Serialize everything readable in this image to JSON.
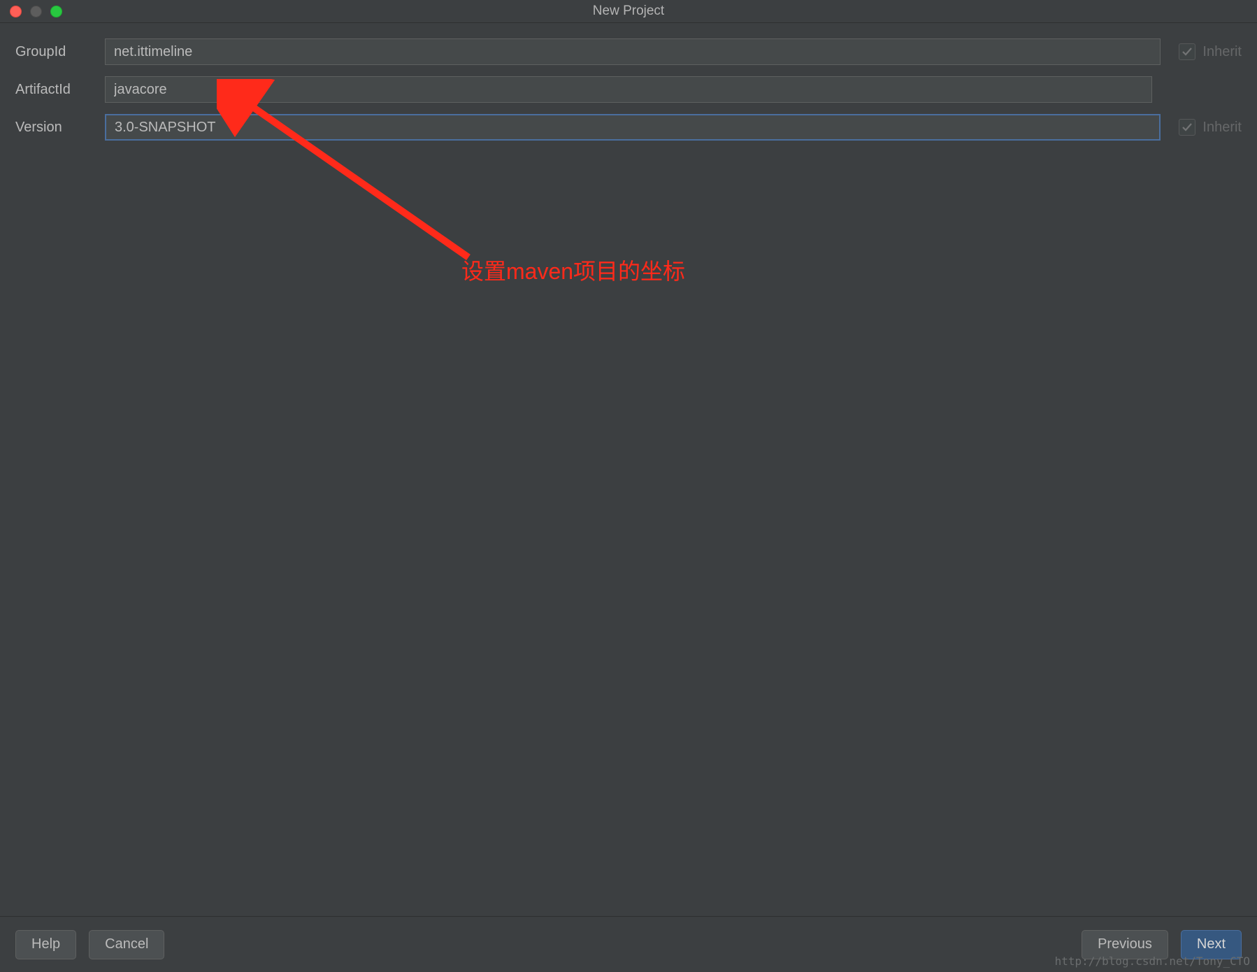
{
  "window": {
    "title": "New Project"
  },
  "form": {
    "groupId": {
      "label": "GroupId",
      "value": "net.ittimeline",
      "inherit_label": "Inherit",
      "inherit_checked": true
    },
    "artifactId": {
      "label": "ArtifactId",
      "value": "javacore"
    },
    "version": {
      "label": "Version",
      "value": "3.0-SNAPSHOT",
      "inherit_label": "Inherit",
      "inherit_checked": true
    }
  },
  "annotation": {
    "text": "设置maven项目的坐标"
  },
  "footer": {
    "help": "Help",
    "cancel": "Cancel",
    "previous": "Previous",
    "next": "Next"
  },
  "watermark": "http://blog.csdn.net/Tony_CTO"
}
